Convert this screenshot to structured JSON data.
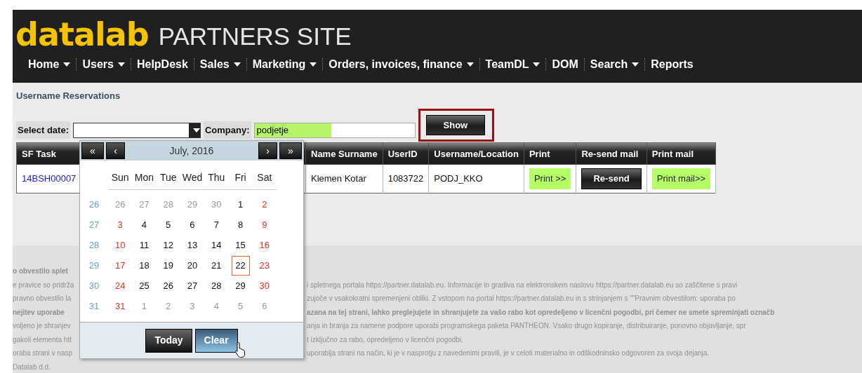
{
  "header": {
    "logo": "datalab",
    "site_title": "PARTNERS SITE"
  },
  "nav": [
    {
      "label": "Home",
      "dropdown": true
    },
    {
      "label": "Users",
      "dropdown": true
    },
    {
      "label": "HelpDesk",
      "dropdown": false
    },
    {
      "label": "Sales",
      "dropdown": true
    },
    {
      "label": "Marketing",
      "dropdown": true
    },
    {
      "label": "Orders, invoices, finance",
      "dropdown": true
    },
    {
      "label": "TeamDL",
      "dropdown": true
    },
    {
      "label": "DOM",
      "dropdown": false
    },
    {
      "label": "Search",
      "dropdown": true
    },
    {
      "label": "Reports",
      "dropdown": false
    }
  ],
  "page_title": "Username Reservations",
  "filters": {
    "date_label": "Select date:",
    "company_label": "Company:",
    "company_value": "podjetje",
    "show_button": "Show",
    "show_highlighted": true
  },
  "table": {
    "columns": [
      "SF Task",
      "Name Surname",
      "UserID",
      "Username/Location",
      "Print",
      "Re-send mail",
      "Print mail"
    ],
    "rows": [
      {
        "sf_task": "14BSH00007",
        "name": "Klemen Kotar",
        "user_id": "1083722",
        "username": "PODJ_KKO",
        "print": "Print >>",
        "resend": "Re-send",
        "print_mail": "Print mail>>"
      }
    ]
  },
  "calendar": {
    "title": "July, 2016",
    "nav": [
      "«",
      "‹",
      "›",
      "»"
    ],
    "weekdays": [
      "Sun",
      "Mon",
      "Tue",
      "Wed",
      "Thu",
      "Fri",
      "Sat"
    ],
    "weeks": [
      {
        "number": "26",
        "days": [
          {
            "label": "26",
            "kind": "other"
          },
          {
            "label": "27",
            "kind": "other"
          },
          {
            "label": "28",
            "kind": "other"
          },
          {
            "label": "29",
            "kind": "other"
          },
          {
            "label": "30",
            "kind": "other"
          },
          {
            "label": "1",
            "kind": "day"
          },
          {
            "label": "2",
            "kind": "weekend"
          }
        ]
      },
      {
        "number": "27",
        "days": [
          {
            "label": "3",
            "kind": "weekend"
          },
          {
            "label": "4",
            "kind": "day"
          },
          {
            "label": "5",
            "kind": "day"
          },
          {
            "label": "6",
            "kind": "day"
          },
          {
            "label": "7",
            "kind": "day"
          },
          {
            "label": "8",
            "kind": "day"
          },
          {
            "label": "9",
            "kind": "weekend"
          }
        ]
      },
      {
        "number": "28",
        "days": [
          {
            "label": "10",
            "kind": "weekend"
          },
          {
            "label": "11",
            "kind": "day"
          },
          {
            "label": "12",
            "kind": "day"
          },
          {
            "label": "13",
            "kind": "day"
          },
          {
            "label": "14",
            "kind": "day"
          },
          {
            "label": "15",
            "kind": "day"
          },
          {
            "label": "16",
            "kind": "weekend"
          }
        ]
      },
      {
        "number": "29",
        "days": [
          {
            "label": "17",
            "kind": "weekend"
          },
          {
            "label": "18",
            "kind": "day"
          },
          {
            "label": "19",
            "kind": "day"
          },
          {
            "label": "20",
            "kind": "day"
          },
          {
            "label": "21",
            "kind": "day"
          },
          {
            "label": "22",
            "kind": "today"
          },
          {
            "label": "23",
            "kind": "weekend"
          }
        ]
      },
      {
        "number": "30",
        "days": [
          {
            "label": "24",
            "kind": "weekend"
          },
          {
            "label": "25",
            "kind": "day"
          },
          {
            "label": "26",
            "kind": "day"
          },
          {
            "label": "27",
            "kind": "day"
          },
          {
            "label": "28",
            "kind": "day"
          },
          {
            "label": "29",
            "kind": "day"
          },
          {
            "label": "30",
            "kind": "weekend"
          }
        ]
      },
      {
        "number": "31",
        "days": [
          {
            "label": "31",
            "kind": "weekend"
          },
          {
            "label": "1",
            "kind": "other"
          },
          {
            "label": "2",
            "kind": "other"
          },
          {
            "label": "3",
            "kind": "other"
          },
          {
            "label": "4",
            "kind": "other"
          },
          {
            "label": "5",
            "kind": "other"
          },
          {
            "label": "6",
            "kind": "other"
          }
        ]
      }
    ],
    "buttons": [
      {
        "label": "Today",
        "hovered": false
      },
      {
        "label": "Clear",
        "hovered": true
      }
    ]
  },
  "footer": [
    {
      "left": "o obvestilo splet",
      "bold": true
    },
    {
      "left": "e pravice so pridrža",
      "right": "i spletnega portala https://partner.datalab.eu. Informacije in gradiva na elektronskem naslovu https://partner.datalab.eu so zaščitene s pravi",
      "bold": false
    },
    {
      "left": "pravno obvestilo la",
      "right": "zujoče v vsakokratni spremenjeni obliki. Z vstopom na portal https://partner.datalab.eu in s strinjanjem s \"\"Pravnim obvestilom: uporaba po",
      "bold": false
    },
    {
      "left": "nejitev uporabe",
      "right": "azana na tej strani, lahko preglejujete in shranjujete za vašo rabo kot opredeljeno v licenčni pogodbi, pri čemer ne smete spreminjati označb",
      "bold": true
    },
    {
      "left": "voljeno je shranjev",
      "right": "anja in branja za namene podpore uporabi programskega paketa PANTHEON. Vsako drugo kopiranje, distribuiranje, ponovno objavljanje, spr",
      "bold": false
    },
    {
      "left": "gakoli elementa htt",
      "right": "t izključno za rabo, opredeljeno v licenčni pogodbi.",
      "bold": false
    },
    {
      "left": "oraba strani v nasp",
      "right": "uporablja strani na način, ki je v nasprotju z navedenimi pravili, je v celoti materialno in odškodninsko odgovoren za svoja dejanja.",
      "bold": false
    },
    {
      "left": "Datalab d.d.",
      "bold": false
    }
  ]
}
